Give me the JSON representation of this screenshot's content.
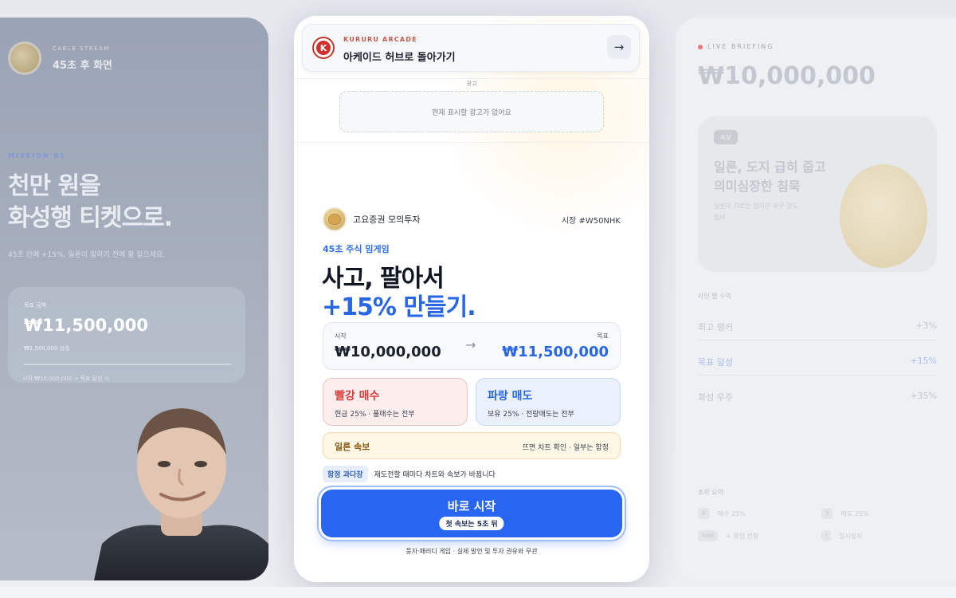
{
  "left_panel": {
    "top_small": "CABLE STREAM",
    "top_title": "45초 후 화면",
    "mission": "MISSION 01",
    "headline_1": "천만 원을",
    "headline_2": "화성행 티켓으로.",
    "subtext": "45초 안에 +15%, 일론이 말하기 전에 팔 잡으세요.",
    "card_small": "목표 금액",
    "card_amount": "₩11,500,000",
    "card_sub": "₩1,500,000 상승",
    "card_foot": "시작 ₩10,000,000 → 목표 달성 시"
  },
  "right_panel": {
    "live_label": "LIVE BRIEFING",
    "amount": "₩10,000,000",
    "badge": "속보",
    "news_title_1": "일론, 도지 급히 줍고",
    "news_title_2": "의미심장한 침묵",
    "news_sub_1": "일론이 차트는 켰지만 아무 말도",
    "news_sub_2": "없네",
    "section": "라인 별 수익",
    "rows": [
      {
        "label": "최고 랭커",
        "value": "+3%"
      },
      {
        "label": "목표 달성",
        "value": "+15%"
      },
      {
        "label": "화성 우주",
        "value": "+35%"
      }
    ],
    "section2": "조작 요약",
    "grid": [
      {
        "chip": "B",
        "text": "매수 25%"
      },
      {
        "chip": "S",
        "text": "매도 25%"
      },
      {
        "chip": "hold",
        "text": "+ 롱업 전환"
      },
      {
        "chip": "i",
        "text": "일시정지"
      }
    ]
  },
  "hub": {
    "logo_letter": "K",
    "brand": "KURURU ARCADE",
    "title": "아케이드 허브로 돌아가기",
    "arrow": "→"
  },
  "ad": {
    "label": "광고",
    "empty_text": "현재 표시할 광고가 없어요"
  },
  "game": {
    "name": "고요증권 모의투자",
    "market_code": "시장 #W50NHK",
    "tagline": "45초 주식 밈게임",
    "headline_1": "사고, 팔아서",
    "headline_2": "+15% 만들기.",
    "start_label": "시작",
    "start_amount": "₩10,000,000",
    "goal_label": "목표",
    "goal_amount": "₩11,500,000",
    "arrow": "→"
  },
  "actions": {
    "buy_title": "빨강 매수",
    "buy_sub": "현금 25% · 풀매수는 전부",
    "sell_title": "파랑 매도",
    "sell_sub": "보유 25% · 전량매도는 전부"
  },
  "news_bar": {
    "title": "일론 속보",
    "sub": "뜨면 차트 확인 · 일부는 함정"
  },
  "trap": {
    "chip": "함정 과다장",
    "text": "재도전할 때마다 차트와 속보가 바뀝니다"
  },
  "start_button": {
    "label": "바로 시작",
    "pill": "첫 속보는 5초 뒤"
  },
  "disclaimer": "풍자·패러디 게임 · 실제 발언 및 투자 권유와 무관",
  "colors": {
    "primary_blue": "#2766e6",
    "buy_red": "#d93b3b",
    "news_gold": "#8a5a10"
  }
}
